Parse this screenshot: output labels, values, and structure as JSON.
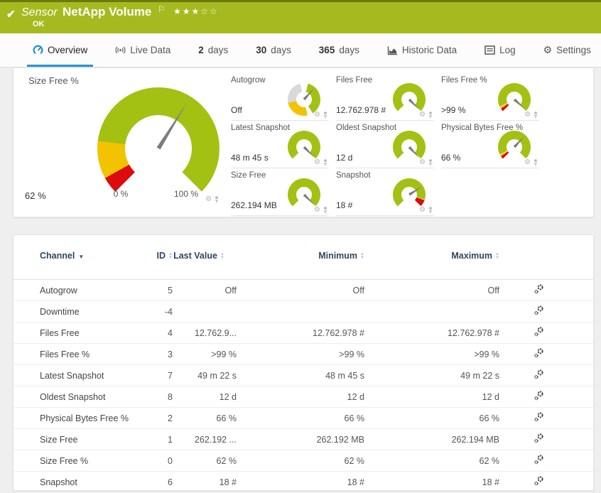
{
  "colors": {
    "brand_green": "#a6ba1f",
    "brand_green_dark": "#6a7a10",
    "accent_blue": "#2196d4",
    "table_header_text": "#2c4764",
    "gauge": {
      "green": "#a3c113",
      "yellow": "#f3c200",
      "red": "#dd0b0b",
      "gray": "#d9d9d9"
    }
  },
  "header": {
    "kind_label": "Sensor",
    "title": "NetApp Volume",
    "status": "OK",
    "priority_stars_filled": 3,
    "priority_stars_total": 5
  },
  "tabs": [
    {
      "label": "Overview",
      "icon": "gauge-icon",
      "active": true
    },
    {
      "label": "Live Data",
      "icon": "broadcast-icon"
    },
    {
      "number": "2",
      "label": "days"
    },
    {
      "number": "30",
      "label": "days"
    },
    {
      "number": "365",
      "label": "days"
    },
    {
      "label": "Historic Data",
      "icon": "chart-icon"
    },
    {
      "label": "Log",
      "icon": "log-icon"
    },
    {
      "label": "Settings",
      "icon": "gear-icon"
    }
  ],
  "main_gauge": {
    "label": "Size Free %",
    "value": "62 %",
    "min_label": "0 %",
    "max_label": "100 %",
    "from_deg": 225,
    "needle_deg": 32,
    "segments": [
      [
        "red",
        0,
        16
      ],
      [
        "yellow",
        16,
        52
      ],
      [
        "green",
        52,
        270
      ]
    ]
  },
  "mini_gauges": [
    {
      "label": "Autogrow",
      "value": "Off",
      "from_deg": 0,
      "needle_deg": 42,
      "segments": [
        [
          "green",
          14,
          148
        ],
        [
          "yellow",
          168,
          258
        ],
        [
          "gray",
          258,
          346
        ]
      ]
    },
    {
      "label": "Files Free",
      "value": "12.762.978 #",
      "from_deg": 225,
      "needle_deg": 135,
      "segments": [
        [
          "green",
          0,
          270
        ]
      ]
    },
    {
      "label": "Files Free %",
      "value": ">99 %",
      "from_deg": 225,
      "needle_deg": 132,
      "segments": [
        [
          "red",
          0,
          10
        ],
        [
          "yellow",
          10,
          17
        ],
        [
          "green",
          19,
          270
        ]
      ]
    },
    {
      "label": "Latest Snapshot",
      "value": "48 m 45 s",
      "from_deg": 225,
      "needle_deg": 135,
      "segments": [
        [
          "green",
          0,
          270
        ]
      ]
    },
    {
      "label": "Oldest Snapshot",
      "value": "12 d",
      "from_deg": 225,
      "needle_deg": 137,
      "segments": [
        [
          "green",
          0,
          270
        ]
      ]
    },
    {
      "label": "Physical Bytes Free %",
      "value": "66 %",
      "from_deg": 225,
      "needle_deg": 43,
      "segments": [
        [
          "red",
          0,
          10
        ],
        [
          "yellow",
          10,
          16
        ],
        [
          "green",
          18,
          270
        ]
      ]
    },
    {
      "label": "Size Free",
      "value": "262.194 MB",
      "from_deg": 225,
      "needle_deg": 135,
      "segments": [
        [
          "green",
          0,
          270
        ]
      ]
    },
    {
      "label": "Snapshot",
      "value": "18 #",
      "from_deg": 225,
      "needle_deg": 58,
      "segments": [
        [
          "green",
          0,
          243
        ],
        [
          "red",
          245,
          270
        ]
      ]
    }
  ],
  "channel_table": {
    "columns": [
      {
        "label": "Channel",
        "sort": "desc"
      },
      {
        "label": "ID",
        "sort": "both"
      },
      {
        "label": "Last Value",
        "sort": "both"
      },
      {
        "label": "Minimum",
        "sort": "both"
      },
      {
        "label": "Maximum",
        "sort": "both"
      }
    ],
    "rows": [
      {
        "channel": "Autogrow",
        "id": "5",
        "last": "Off",
        "min": "Off",
        "max": "Off"
      },
      {
        "channel": "Downtime",
        "id": "-4",
        "last": "",
        "min": "",
        "max": ""
      },
      {
        "channel": "Files Free",
        "id": "4",
        "last": "12.762.9...",
        "min": "12.762.978 #",
        "max": "12.762.978 #"
      },
      {
        "channel": "Files Free %",
        "id": "3",
        "last": ">99 %",
        "min": ">99 %",
        "max": ">99 %"
      },
      {
        "channel": "Latest Snapshot",
        "id": "7",
        "last": "49 m 22 s",
        "min": "48 m 45 s",
        "max": "49 m 22 s"
      },
      {
        "channel": "Oldest Snapshot",
        "id": "8",
        "last": "12 d",
        "min": "12 d",
        "max": "12 d"
      },
      {
        "channel": "Physical Bytes Free %",
        "id": "2",
        "last": "66 %",
        "min": "66 %",
        "max": "66 %"
      },
      {
        "channel": "Size Free",
        "id": "1",
        "last": "262.192 ...",
        "min": "262.192 MB",
        "max": "262.194 MB"
      },
      {
        "channel": "Size Free %",
        "id": "0",
        "last": "62 %",
        "min": "62 %",
        "max": "62 %"
      },
      {
        "channel": "Snapshot",
        "id": "6",
        "last": "18 #",
        "min": "18 #",
        "max": "18 #"
      }
    ]
  }
}
